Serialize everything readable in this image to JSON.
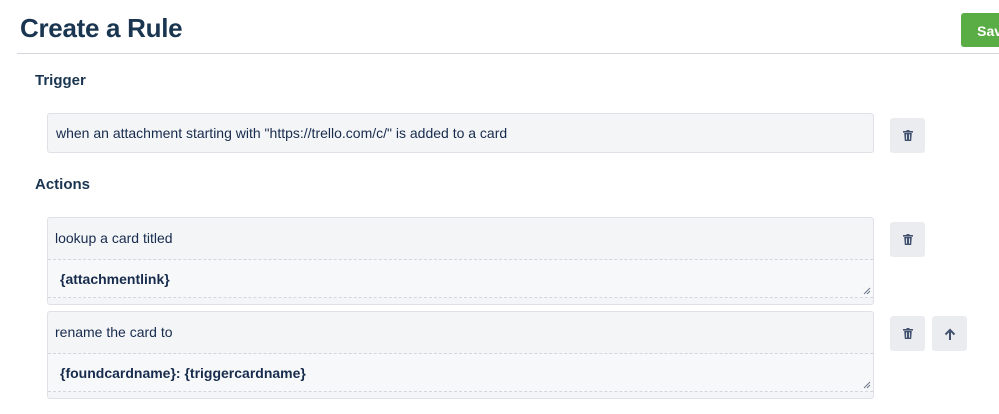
{
  "header": {
    "title": "Create a Rule",
    "save_label": "Save"
  },
  "trigger": {
    "label": "Trigger",
    "text": "when an attachment starting with \"https://trello.com/c/\" is added to a card"
  },
  "actions": {
    "label": "Actions",
    "items": [
      {
        "text": "lookup a card titled",
        "field": "{attachmentlink}"
      },
      {
        "text": "rename the card to",
        "field": "{foundcardname}: {triggercardname}"
      }
    ]
  },
  "icons": {
    "delete": "trash-icon",
    "move_up": "arrow-up-icon"
  },
  "colors": {
    "accent": "#5aac44",
    "title": "#1a3550",
    "panel": "#f4f5f7"
  }
}
